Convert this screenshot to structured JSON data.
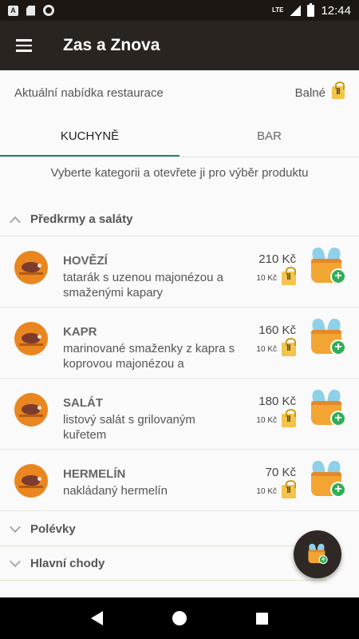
{
  "status_bar": {
    "left_icons": [
      "A",
      "sd-card-icon",
      "circle-icon"
    ],
    "lte": "LTE",
    "time": "12:44"
  },
  "app_bar": {
    "title": "Zas a Znova"
  },
  "header": {
    "subtitle": "Aktuální nabídka restaurace",
    "location": "Balné"
  },
  "tabs": [
    {
      "label": "KUCHYNĚ",
      "active": true
    },
    {
      "label": "BAR",
      "active": false
    }
  ],
  "hint": "Vyberte kategorii a otevřete ji pro výběr produktu",
  "categories": [
    {
      "label": "Předkrmy a saláty",
      "expanded": true
    },
    {
      "label": "Polévky",
      "expanded": false
    },
    {
      "label": "Hlavní chody",
      "expanded": false
    }
  ],
  "items": [
    {
      "name": "HOVĚZÍ",
      "desc": "tatarák s uzenou majonézou a smaženými kapary",
      "price": "210 Kč",
      "pack_price": "10 Kč"
    },
    {
      "name": "KAPR",
      "desc": "marinované smaženky z kapra s koprovou majonézou a",
      "price": "160 Kč",
      "pack_price": "10 Kč"
    },
    {
      "name": "SALÁT",
      "desc": "listový salát s grilovaným kuřetem",
      "price": "180 Kč",
      "pack_price": "10 Kč"
    },
    {
      "name": "HERMELÍN",
      "desc": "nakládaný hermelín",
      "price": "70 Kč",
      "pack_price": "10 Kč"
    }
  ],
  "colors": {
    "app_bar": "#2a2420",
    "tab_indicator": "#21807a",
    "avatar": "#e9861f",
    "basket": "#f2a532",
    "basket_plus": "#2eaf56"
  }
}
